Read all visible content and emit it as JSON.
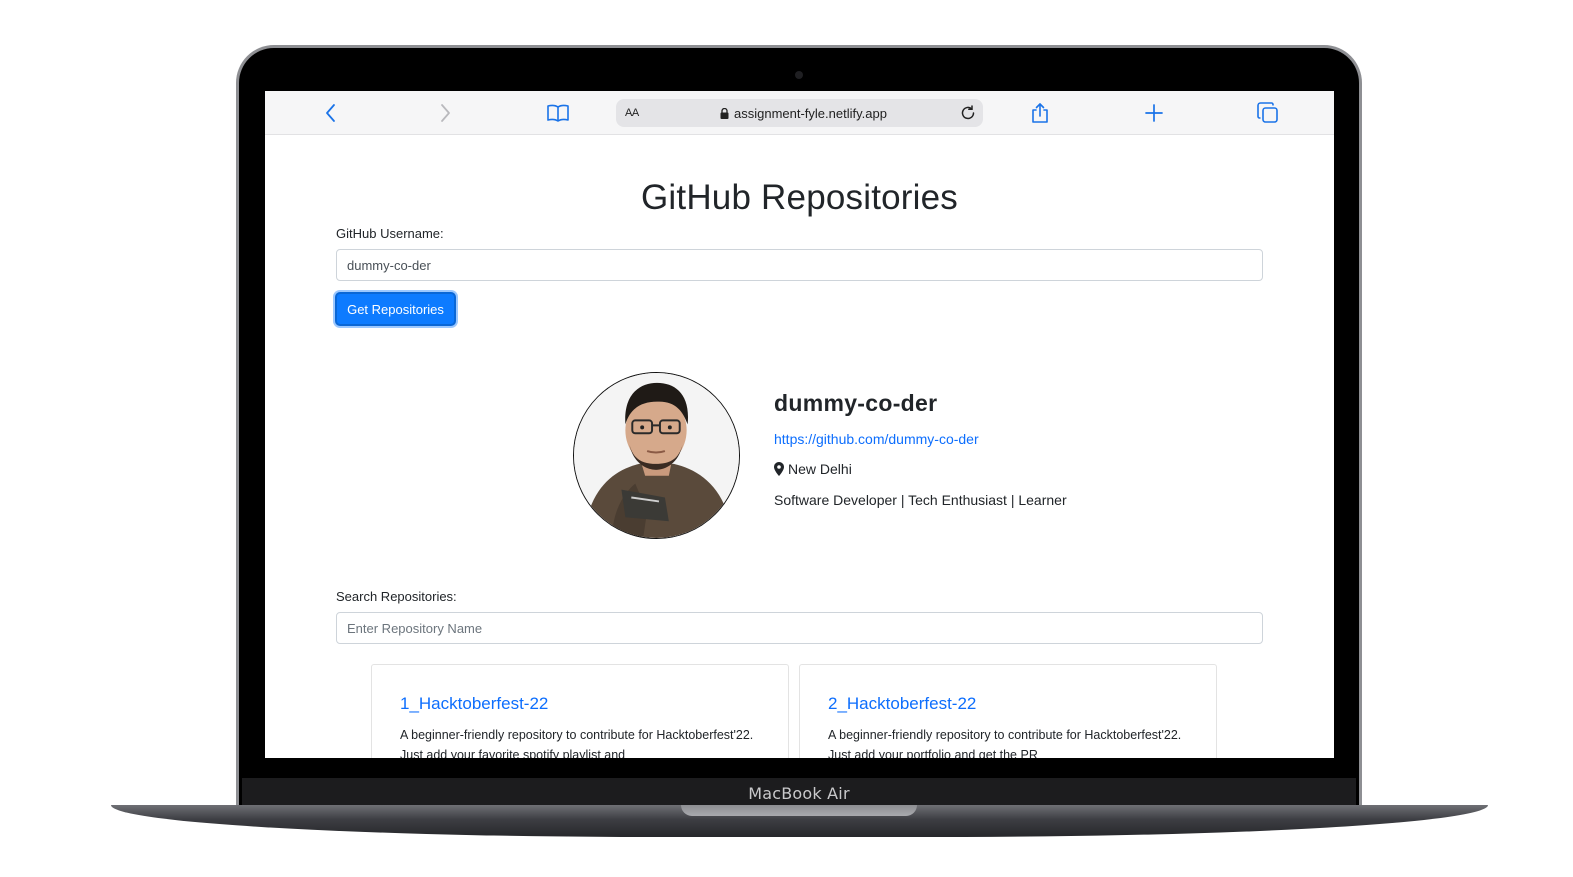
{
  "device": {
    "model_label": "MacBook Air"
  },
  "browser": {
    "text_size_label": "AA",
    "url": "assignment-fyle.netlify.app",
    "icons": [
      "back-icon",
      "forward-icon",
      "bookmarks-icon",
      "lock-icon",
      "reload-icon",
      "share-icon",
      "new-tab-icon",
      "tabs-icon"
    ]
  },
  "page": {
    "title": "GitHub Repositories",
    "username_label": "GitHub Username:",
    "username_value": "dummy-co-der",
    "get_button_label": "Get Repositories",
    "search_label": "Search Repositories:",
    "search_placeholder": "Enter Repository Name"
  },
  "profile": {
    "name": "dummy-co-der",
    "url": "https://github.com/dummy-co-der",
    "location": "New Delhi",
    "bio": "Software Developer | Tech Enthusiast | Learner"
  },
  "repositories": [
    {
      "name": "1_Hacktoberfest-22",
      "description": "A beginner-friendly repository to contribute for Hacktoberfest'22. Just add your favorite spotify playlist and"
    },
    {
      "name": "2_Hacktoberfest-22",
      "description": "A beginner-friendly repository to contribute for Hacktoberfest'22. Just add your portfolio and get the PR"
    }
  ],
  "colors": {
    "accent": "#0d6efd",
    "button": "#0d7bff",
    "safari_blue": "#1a73e8"
  }
}
